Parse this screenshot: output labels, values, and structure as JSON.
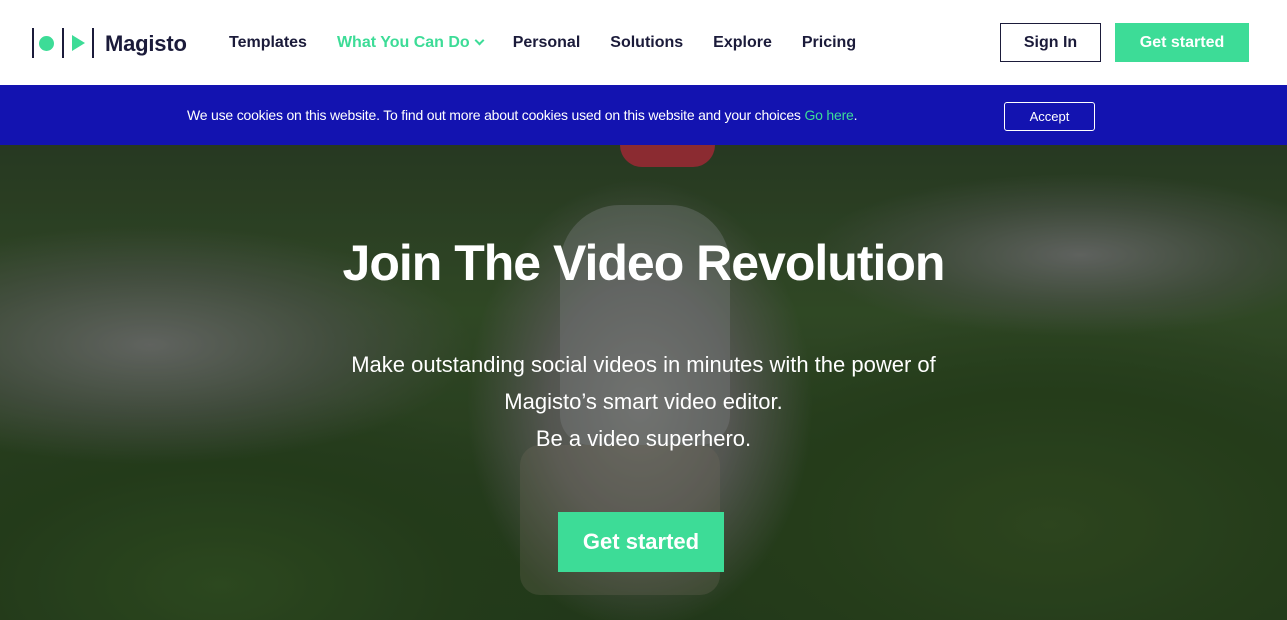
{
  "brand": {
    "name": "Magisto",
    "accent": "#3ddc97",
    "dark": "#1b1b3a",
    "cookie_bg": "#1313b0"
  },
  "nav": {
    "items": [
      {
        "label": "Templates",
        "active": false
      },
      {
        "label": "What You Can Do",
        "active": true,
        "has_dropdown": true
      },
      {
        "label": "Personal",
        "active": false
      },
      {
        "label": "Solutions",
        "active": false
      },
      {
        "label": "Explore",
        "active": false
      },
      {
        "label": "Pricing",
        "active": false
      }
    ],
    "sign_in": "Sign In",
    "get_started": "Get started"
  },
  "cookie": {
    "text": "We use cookies on this website. To find out more about cookies used on this website and your choices ",
    "link": "Go here",
    "suffix": ".",
    "accept": "Accept"
  },
  "hero": {
    "title": "Join The Video Revolution",
    "line1": "Make outstanding social videos in minutes with the power of",
    "line2": "Magisto’s smart video editor.",
    "line3": "Be a video superhero.",
    "cta": "Get started"
  }
}
